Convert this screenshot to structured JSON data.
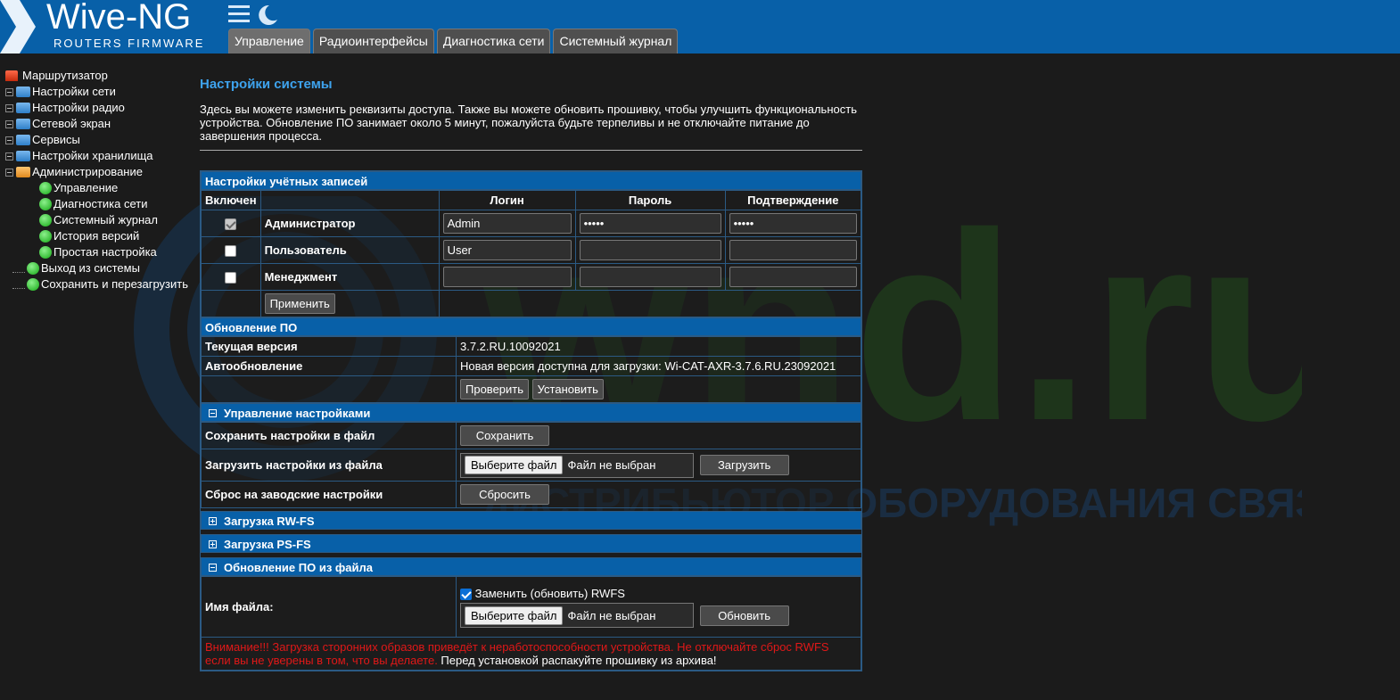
{
  "header": {
    "logo_title": "Wive-NG",
    "logo_subtitle": "ROUTERS FIRMWARE",
    "menu_icon": "hamburger-icon",
    "theme_icon": "moon-icon",
    "tabs": [
      "Управление",
      "Радиоинтерфейсы",
      "Диагностика сети",
      "Системный журнал"
    ],
    "active_tab": "Управление",
    "color": "#0860a8"
  },
  "tree": {
    "root": "Маршрутизатор",
    "items": [
      "Настройки сети",
      "Настройки радио",
      "Сетевой экран",
      "Сервисы",
      "Настройки хранилища",
      "Администрирование"
    ],
    "admin_children": [
      "Управление",
      "Диагностика сети",
      "Системный журнал",
      "История версий",
      "Простая настройка"
    ],
    "bottom_items": [
      "Выход из системы",
      "Сохранить и перезагрузить"
    ]
  },
  "watermark": {
    "text": "wnd.ru",
    "subtext": "ДИСТРИБЬЮТОР ОБОРУДОВАНИЯ СВЯЗИ"
  },
  "page": {
    "title": "Настройки системы",
    "description": "Здесь вы можете изменить реквизиты доступа. Также вы можете обновить прошивку, чтобы улучшить функциональность устройства. Обновление ПО занимает около 5 минут, пожалуйста будьте терпеливы и не отключайте питание до завершения процесса."
  },
  "accounts": {
    "header": "Настройки учётных записей",
    "columns": [
      "Включен",
      "",
      "Логин",
      "Пароль",
      "Подтверждение"
    ],
    "rows": [
      {
        "enabled": true,
        "name": "Администратор",
        "login": "Admin",
        "password": "•••••",
        "confirm": "•••••"
      },
      {
        "enabled": false,
        "name": "Пользователь",
        "login": "User",
        "password": "",
        "confirm": ""
      },
      {
        "enabled": false,
        "name": "Менеджмент",
        "login": "",
        "password": "",
        "confirm": ""
      }
    ],
    "apply_label": "Применить"
  },
  "firmware": {
    "header": "Обновление ПО",
    "current_label": "Текущая версия",
    "current_value": "3.7.2.RU.10092021",
    "auto_label": "Автообновление",
    "auto_value": "Новая версия доступна для загрузки: Wi-CAT-AXR-3.7.6.RU.23092021",
    "check_label": "Проверить",
    "install_label": "Установить"
  },
  "settings_mgmt": {
    "header": "Управление настройками",
    "save_label": "Сохранить настройки в файл",
    "save_button": "Сохранить",
    "load_label": "Загрузить настройки из файла",
    "choose_file": "Выберите файл",
    "no_file": "Файл не выбран",
    "load_button": "Загрузить",
    "reset_label": "Сброс на заводские настройки",
    "reset_button": "Сбросить"
  },
  "rwfs": {
    "header": "Загрузка RW-FS"
  },
  "psfs": {
    "header": "Загрузка PS-FS"
  },
  "fw_file": {
    "header": "Обновление ПО из файла",
    "file_label": "Имя файла:",
    "replace_rwfs": "Заменить (обновить) RWFS",
    "choose_file": "Выберите файл",
    "no_file": "Файл не выбран",
    "update_button": "Обновить",
    "warning_red": "Внимание!!! Загрузка сторонних образов приведёт к неработоспособности устройства. Не отключайте сброс RWFS если вы не уверены в том, что вы делаете.",
    "warning_white": " Перед установкой распакуйте прошивку из архива!"
  }
}
